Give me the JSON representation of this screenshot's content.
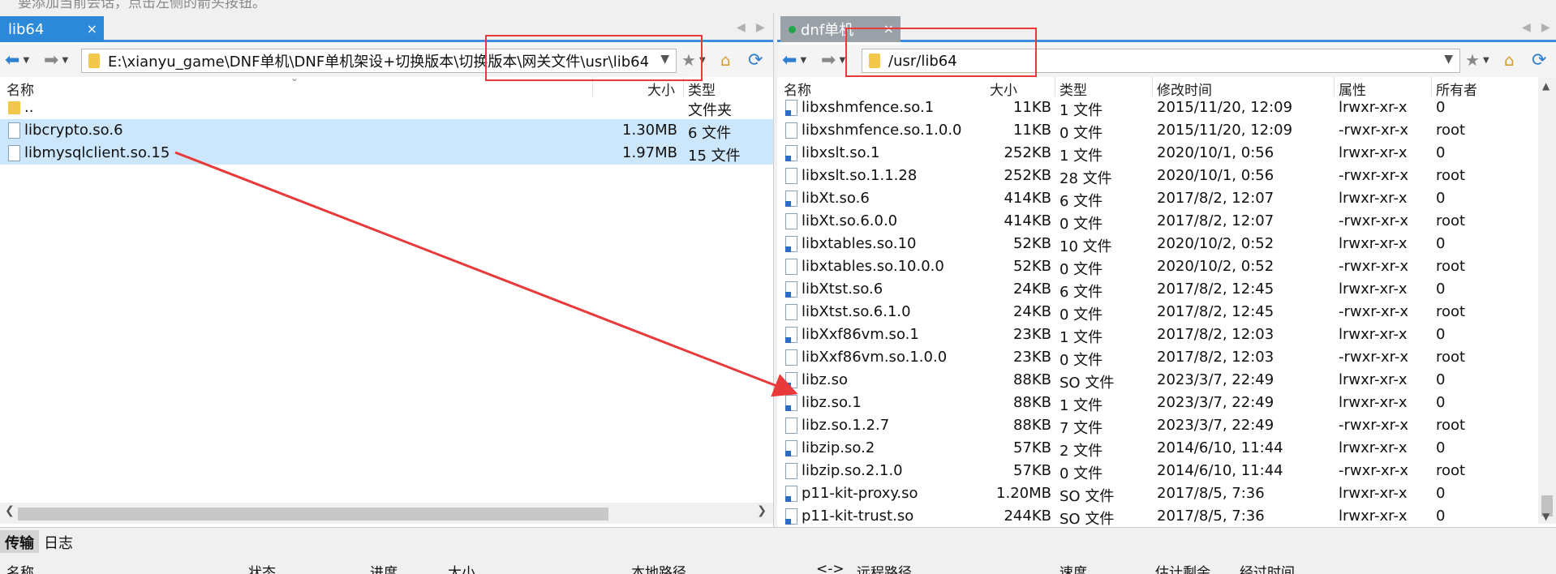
{
  "hint": "要添加当前会话，点击左侧的箭头按钮。",
  "left": {
    "tab_title": "lib64",
    "tab_close": "×",
    "path": "E:\\xianyu_game\\DNF单机\\DNF单机架设+切换版本\\切换版本\\网关文件\\usr\\lib64",
    "columns": {
      "name": "名称",
      "size": "大小",
      "type": "类型"
    },
    "parent_row": {
      "name": "..",
      "type": "文件夹"
    },
    "files": [
      {
        "name": "libcrypto.so.6",
        "size": "1.30MB",
        "type": "6 文件"
      },
      {
        "name": "libmysqlclient.so.15",
        "size": "1.97MB",
        "type": "15 文件"
      }
    ]
  },
  "right": {
    "tab_title": "dnf单机",
    "tab_close": "×",
    "path": "/usr/lib64",
    "columns": {
      "name": "名称",
      "size": "大小",
      "type": "类型",
      "mtime": "修改时间",
      "attr": "属性",
      "owner": "所有者"
    },
    "files": [
      {
        "name": "libxshmfence.so.1",
        "size": "11KB",
        "type": "1 文件",
        "mtime": "2015/11/20, 12:09",
        "attr": "lrwxr-xr-x",
        "owner": "0",
        "link": true
      },
      {
        "name": "libxshmfence.so.1.0.0",
        "size": "11KB",
        "type": "0 文件",
        "mtime": "2015/11/20, 12:09",
        "attr": "-rwxr-xr-x",
        "owner": "root",
        "link": false
      },
      {
        "name": "libxslt.so.1",
        "size": "252KB",
        "type": "1 文件",
        "mtime": "2020/10/1, 0:56",
        "attr": "lrwxr-xr-x",
        "owner": "0",
        "link": true
      },
      {
        "name": "libxslt.so.1.1.28",
        "size": "252KB",
        "type": "28 文件",
        "mtime": "2020/10/1, 0:56",
        "attr": "-rwxr-xr-x",
        "owner": "root",
        "link": false
      },
      {
        "name": "libXt.so.6",
        "size": "414KB",
        "type": "6 文件",
        "mtime": "2017/8/2, 12:07",
        "attr": "lrwxr-xr-x",
        "owner": "0",
        "link": true
      },
      {
        "name": "libXt.so.6.0.0",
        "size": "414KB",
        "type": "0 文件",
        "mtime": "2017/8/2, 12:07",
        "attr": "-rwxr-xr-x",
        "owner": "root",
        "link": false
      },
      {
        "name": "libxtables.so.10",
        "size": "52KB",
        "type": "10 文件",
        "mtime": "2020/10/2, 0:52",
        "attr": "lrwxr-xr-x",
        "owner": "0",
        "link": true
      },
      {
        "name": "libxtables.so.10.0.0",
        "size": "52KB",
        "type": "0 文件",
        "mtime": "2020/10/2, 0:52",
        "attr": "-rwxr-xr-x",
        "owner": "root",
        "link": false
      },
      {
        "name": "libXtst.so.6",
        "size": "24KB",
        "type": "6 文件",
        "mtime": "2017/8/2, 12:45",
        "attr": "lrwxr-xr-x",
        "owner": "0",
        "link": true
      },
      {
        "name": "libXtst.so.6.1.0",
        "size": "24KB",
        "type": "0 文件",
        "mtime": "2017/8/2, 12:45",
        "attr": "-rwxr-xr-x",
        "owner": "root",
        "link": false
      },
      {
        "name": "libXxf86vm.so.1",
        "size": "23KB",
        "type": "1 文件",
        "mtime": "2017/8/2, 12:03",
        "attr": "lrwxr-xr-x",
        "owner": "0",
        "link": true
      },
      {
        "name": "libXxf86vm.so.1.0.0",
        "size": "23KB",
        "type": "0 文件",
        "mtime": "2017/8/2, 12:03",
        "attr": "-rwxr-xr-x",
        "owner": "root",
        "link": false
      },
      {
        "name": "libz.so",
        "size": "88KB",
        "type": "SO 文件",
        "mtime": "2023/3/7, 22:49",
        "attr": "lrwxr-xr-x",
        "owner": "0",
        "link": true
      },
      {
        "name": "libz.so.1",
        "size": "88KB",
        "type": "1 文件",
        "mtime": "2023/3/7, 22:49",
        "attr": "lrwxr-xr-x",
        "owner": "0",
        "link": true
      },
      {
        "name": "libz.so.1.2.7",
        "size": "88KB",
        "type": "7 文件",
        "mtime": "2023/3/7, 22:49",
        "attr": "-rwxr-xr-x",
        "owner": "root",
        "link": false
      },
      {
        "name": "libzip.so.2",
        "size": "57KB",
        "type": "2 文件",
        "mtime": "2014/6/10, 11:44",
        "attr": "lrwxr-xr-x",
        "owner": "0",
        "link": true
      },
      {
        "name": "libzip.so.2.1.0",
        "size": "57KB",
        "type": "0 文件",
        "mtime": "2014/6/10, 11:44",
        "attr": "-rwxr-xr-x",
        "owner": "root",
        "link": false
      },
      {
        "name": "p11-kit-proxy.so",
        "size": "1.20MB",
        "type": "SO 文件",
        "mtime": "2017/8/5, 7:36",
        "attr": "lrwxr-xr-x",
        "owner": "0",
        "link": true
      },
      {
        "name": "p11-kit-trust.so",
        "size": "244KB",
        "type": "SO 文件",
        "mtime": "2017/8/5, 7:36",
        "attr": "lrwxr-xr-x",
        "owner": "0",
        "link": true
      }
    ]
  },
  "bottom": {
    "tabs": [
      "传输",
      "日志"
    ],
    "columns": [
      "名称",
      "状态",
      "进度",
      "大小",
      "本地路径",
      "<->",
      "远程路径",
      "速度",
      "估计剩余...",
      "经过时间"
    ]
  },
  "colors": {
    "accent": "#2c88d9",
    "selection": "#cce6fb",
    "annotation": "#e8393b"
  }
}
